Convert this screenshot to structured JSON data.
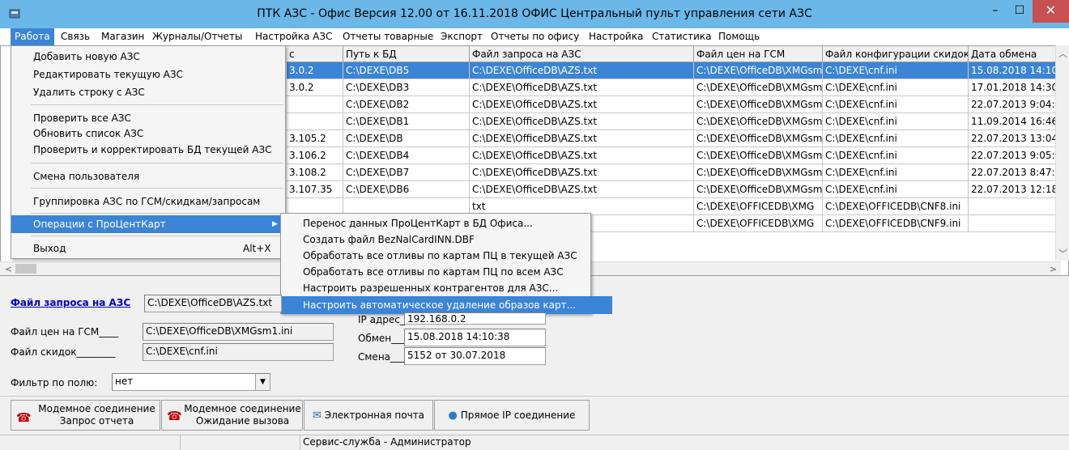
{
  "window": {
    "title": "ПТК АЗС - Офис Версия 12.00 от 16.11.2018 ОФИС Центральный пульт управления сети АЗС",
    "min_glyph": "–",
    "max_glyph": "☐",
    "close_glyph": "✕"
  },
  "menubar": [
    "Работа",
    "Связь",
    "Магазин",
    "Журналы/Отчеты",
    "Настройка АЗС",
    "Отчеты товарные",
    "Экспорт",
    "Отчеты по офису",
    "Настройка",
    "Статистика",
    "Помощь"
  ],
  "grid": {
    "headers": [
      "с",
      "Путь к БД",
      "Файл запроса на АЗС",
      "Файл цен на ГСМ",
      "Файл конфигурации скидок",
      "Дата обмена"
    ],
    "rows": [
      [
        "3.0.2",
        "C:\\DEXE\\DB5",
        "C:\\DEXE\\OfficeDB\\AZS.txt",
        "C:\\DEXE\\OfficeDB\\XMGsm",
        "C:\\DEXE\\cnf.ini",
        "15.08.2018 14:10"
      ],
      [
        "3.0.2",
        "C:\\DEXE\\DB3",
        "C:\\DEXE\\OfficeDB\\AZS.txt",
        "C:\\DEXE\\OfficeDB\\XMGsm",
        "C:\\DEXE\\cnf.ini",
        "17.01.2018 14:30"
      ],
      [
        "",
        "C:\\DEXE\\DB2",
        "C:\\DEXE\\OfficeDB\\AZS.txt",
        "C:\\DEXE\\OfficeDB\\XMGsm",
        "C:\\DEXE\\cnf.ini",
        "22.07.2013 9:04:5"
      ],
      [
        "",
        "C:\\DEXE\\DB1",
        "C:\\DEXE\\OfficeDB\\AZS.txt",
        "C:\\DEXE\\OfficeDB\\XMGsm",
        "C:\\DEXE\\cnf.ini",
        "11.09.2014 16:46"
      ],
      [
        "3.105.2",
        "C:\\DEXE\\DB",
        "C:\\DEXE\\OfficeDB\\AZS.txt",
        "C:\\DEXE\\OfficeDB\\XMGsm",
        "C:\\DEXE\\cnf.ini",
        "22.07.2013 13:04"
      ],
      [
        "3.106.2",
        "C:\\DEXE\\DB4",
        "C:\\DEXE\\OfficeDB\\AZS.txt",
        "C:\\DEXE\\OfficeDB\\XMGsm",
        "C:\\DEXE\\cnf.ini",
        "22.07.2013 9:05:4"
      ],
      [
        "3.108.2",
        "C:\\DEXE\\DB7",
        "C:\\DEXE\\OfficeDB\\AZS.txt",
        "C:\\DEXE\\OfficeDB\\XMGsm",
        "C:\\DEXE\\cnf.ini",
        "22.07.2013 8:47:2"
      ],
      [
        "3.107.35",
        "C:\\DEXE\\DB6",
        "C:\\DEXE\\OfficeDB\\AZS.txt",
        "C:\\DEXE\\OfficeDB\\XMGsm",
        "C:\\DEXE\\cnf.ini",
        "22.07.2013 12:18"
      ],
      [
        "",
        "",
        "txt",
        "C:\\DEXE\\OFFICEDB\\XMG",
        "C:\\DEXE\\OFFICEDB\\CNF8.ini",
        ""
      ],
      [
        "",
        "",
        "txt",
        "C:\\DEXE\\OFFICEDB\\XMG",
        "C:\\DEXE\\OFFICEDB\\CNF9.ini",
        ""
      ]
    ]
  },
  "work_menu": {
    "items": [
      "Добавить новую АЗС",
      "Редактировать текущую АЗС",
      "Удалить строку с АЗС",
      "Проверить все АЗС",
      "Обновить список АЗС",
      "Проверить и корректировать БД текущей АЗС",
      "Смена пользователя",
      "Группировка АЗС по ГСМ/скидкам/запросам",
      "Операции с ПроЦентКарт",
      "Выход"
    ],
    "exit_shortcut": "Alt+X",
    "submenu_arrow": "▶"
  },
  "submenu": {
    "items": [
      "Перенос данных ПроЦентКарт в БД Офиса...",
      "Создать файл BezNalCardINN.DBF",
      "Обработать все отливы по картам ПЦ в текущей АЗС",
      "Обработать все отливы по картам ПЦ по всем АЗС",
      "Настроить разрешенных контрагентов для АЗС...",
      "Настроить автоматическое удаление образов карт..."
    ]
  },
  "details": {
    "request_file_link": "Файл запроса на АЗС",
    "request_file_value": "C:\\DEXE\\OfficeDB\\AZS.txt",
    "prices_label": "Файл цен на ГСМ____",
    "prices_value": "C:\\DEXE\\OfficeDB\\XMGsm1.ini",
    "discounts_label": "Файл скидок________",
    "discounts_value": "C:\\DEXE\\cnf.ini",
    "ip_label": "IP адрес_",
    "ip_value": "192.168.0.2",
    "exchange_label": "Обмен___",
    "exchange_value": "15.08.2018 14:10:38",
    "shift_label": "Смена___",
    "shift_value": "5152 от 30.07.2018"
  },
  "filter": {
    "label": "Фильтр по полю:",
    "value": "нет",
    "arrow": "▼"
  },
  "buttons": {
    "modem_request_line1": "Модемное соединение",
    "modem_request_line2": "Запрос отчета",
    "modem_wait_line1": "Модемное соединение",
    "modem_wait_line2": "Ожидание вызова",
    "email": "Электронная почта",
    "direct_ip": "Прямое IP соединение"
  },
  "statusbar": {
    "text": "Сервис-служба - Администратор"
  },
  "colors": {
    "titlebar": "#6bb8e8",
    "selection": "#3b84d6",
    "link": "#0000cc",
    "close": "#c75050"
  }
}
